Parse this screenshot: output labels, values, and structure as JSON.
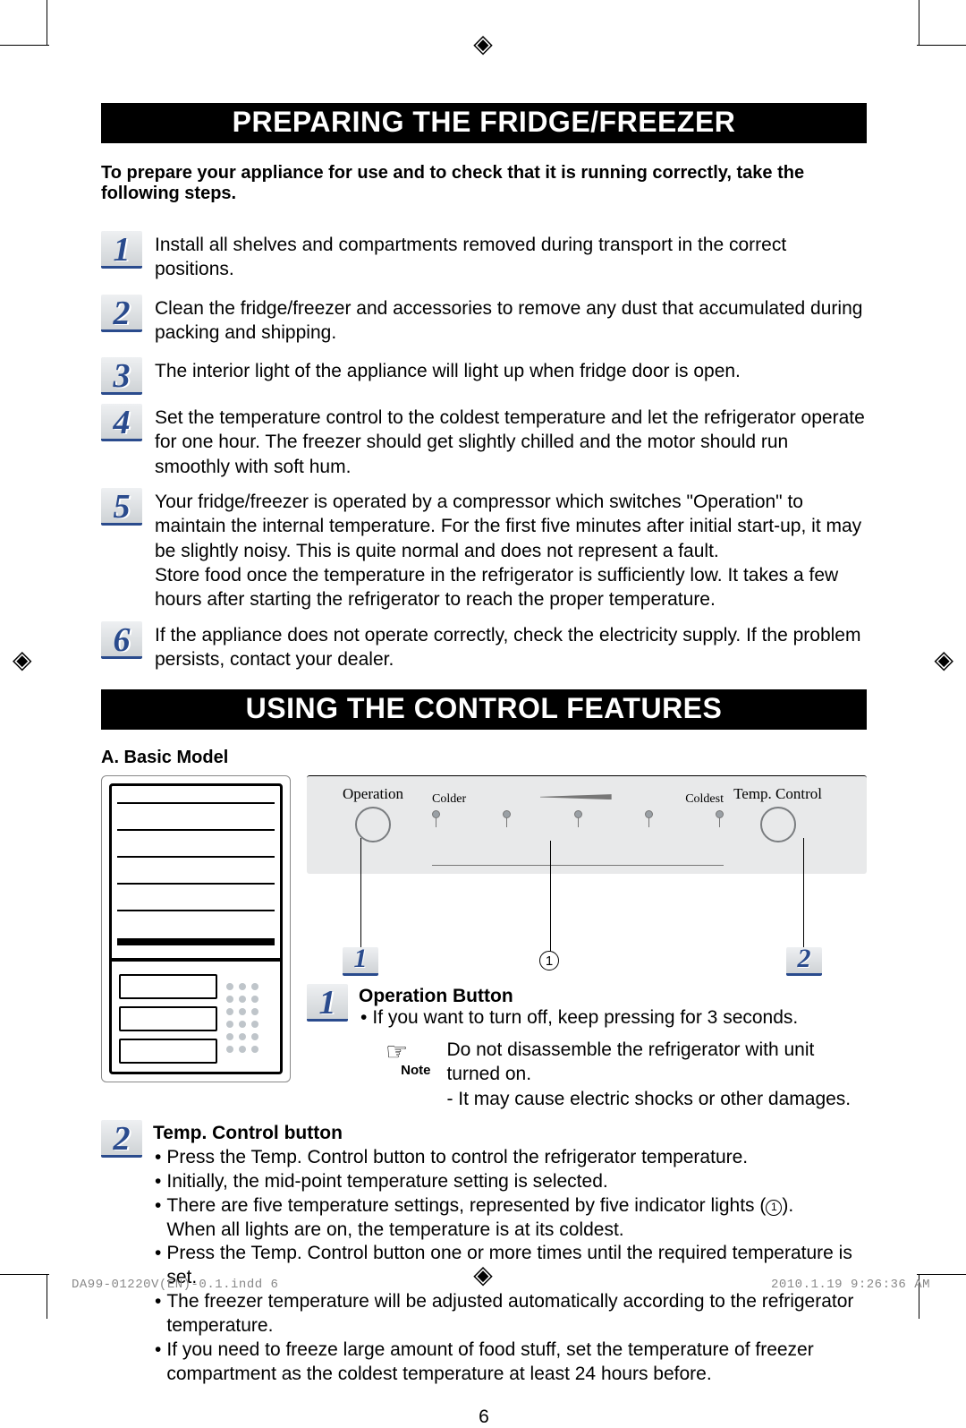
{
  "section1_title": "PREPARING THE FRIDGE/FREEZER",
  "section1_subtitle": "To prepare your appliance for use and to check that it is running correctly, take the following steps.",
  "steps": {
    "s1": "Install all shelves and compartments removed during transport in the correct positions.",
    "s2": "Clean the fridge/freezer and accessories to remove any dust that accumulated during packing and shipping.",
    "s3": "The interior light of the appliance will light up when fridge door is open.",
    "s4": "Set the temperature control to the coldest temperature and let the refrigerator operate for one hour. The freezer should get slightly chilled and the motor should run smoothly with soft hum.",
    "s5a": "Your fridge/freezer is operated by a compressor which switches \"Operation\" to maintain the internal temperature. For the first five minutes after initial start-up, it may be slightly noisy. This is quite normal and does not represent a fault.",
    "s5b": "Store food once the temperature in the refrigerator is sufficiently low. It takes a few hours after starting the refrigerator to reach the proper temperature.",
    "s6": "If the appliance does not operate correctly, check the electricity supply. If the problem persists, contact your dealer."
  },
  "section2_title": "USING THE CONTROL FEATURES",
  "model_label": "A. Basic Model",
  "panel": {
    "operation": "Operation",
    "colder": "Colder",
    "coldest": "Coldest",
    "temp_control": "Temp. Control",
    "ind1": "1",
    "p1": "1",
    "p2": "2"
  },
  "ctrl1": {
    "title": "Operation Button",
    "b1": "If you want to turn off, keep pressing for 3 seconds.",
    "note_label": "Note",
    "note_l1": "Do not disassemble the refrigerator with unit turned on.",
    "note_l2": "- It may cause electric shocks or other damages."
  },
  "ctrl2": {
    "title": "Temp. Control button",
    "b1": "Press the Temp. Control button to control the refrigerator temperature.",
    "b2": "Initially, the mid-point temperature setting is selected.",
    "b3a": "There are five temperature settings, represented by five indicator lights (",
    "b3_ind": "1",
    "b3b": ").",
    "b3c": "When all lights are on, the temperature is at its coldest.",
    "b4": "Press the Temp. Control button one or more times until the required temperature is set.",
    "b5": "The freezer temperature will be adjusted automatically according to the refrigerator temperature.",
    "b6": "If you need to freeze large amount of food stuff, set the temperature of freezer compartment as the coldest temperature at least 24 hours before."
  },
  "page_number": "6",
  "footer_left": "DA99-01220V(EN)-0.1.indd   6",
  "footer_right": "2010.1.19   9:26:36 AM"
}
